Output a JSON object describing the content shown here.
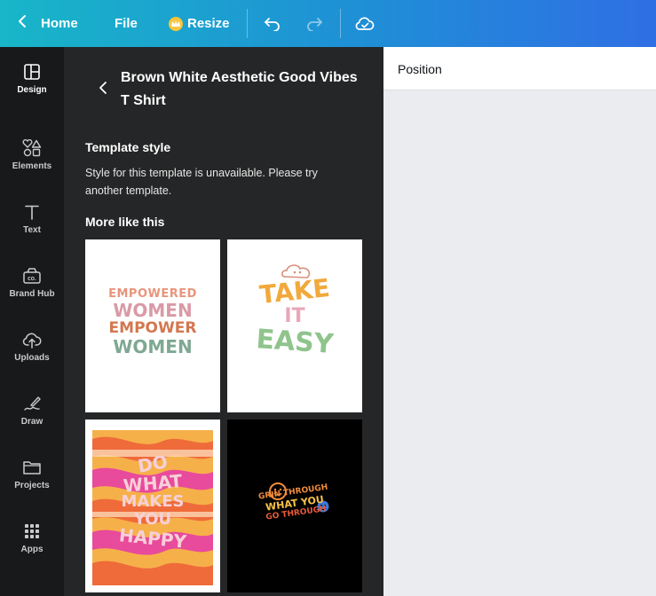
{
  "topbar": {
    "home_label": "Home",
    "file_label": "File",
    "resize_label": "Resize"
  },
  "rail": {
    "items": [
      {
        "label": "Design",
        "icon": "layout-icon"
      },
      {
        "label": "Elements",
        "icon": "shapes-icon"
      },
      {
        "label": "Text",
        "icon": "text-icon"
      },
      {
        "label": "Brand Hub",
        "icon": "brand-hub-icon"
      },
      {
        "label": "Uploads",
        "icon": "cloud-upload-icon"
      },
      {
        "label": "Draw",
        "icon": "draw-icon"
      },
      {
        "label": "Projects",
        "icon": "folder-icon"
      },
      {
        "label": "Apps",
        "icon": "apps-grid-icon"
      }
    ]
  },
  "panel": {
    "title": "Brown White Aesthetic Good Vibes T Shirt",
    "template_style_heading": "Template style",
    "template_style_text": "Style for this template is unavailable. Please try another template.",
    "more_heading": "More like this",
    "thumbs": [
      {
        "lines": [
          "EMPOWERED",
          "WOMEN",
          "EMPOWER",
          "WOMEN"
        ],
        "bg": "#ffffff"
      },
      {
        "lines": [
          "TAKE",
          "IT",
          "EASY"
        ],
        "bg": "#ffffff"
      },
      {
        "lines": [
          "DO",
          "WHAT",
          "MAKES",
          "YOU",
          "HAPPY"
        ],
        "bg": "#ffffff"
      },
      {
        "lines": [
          "GRIN THROUGH",
          "WHAT YOU",
          "GO THROUGH"
        ],
        "bg": "#000000"
      }
    ]
  },
  "right": {
    "position_label": "Position"
  },
  "colors": {
    "topbar_start": "#18b6c8",
    "topbar_end": "#2f6fe4",
    "panel_bg": "#252627",
    "rail_bg": "#18191b",
    "crown": "#f9c53a"
  }
}
